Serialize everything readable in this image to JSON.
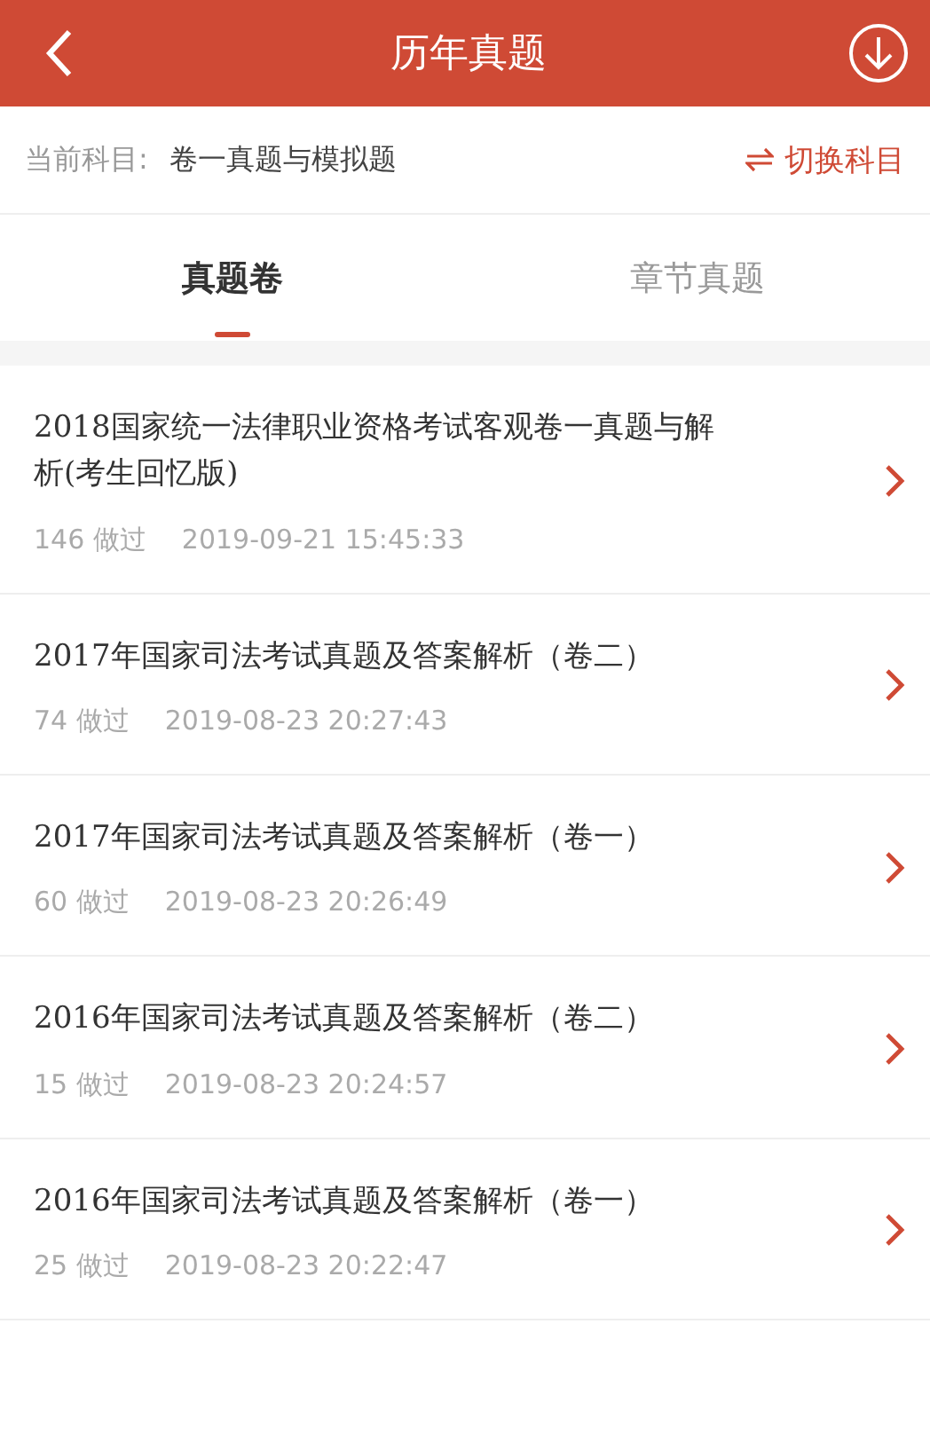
{
  "header": {
    "title": "历年真题"
  },
  "subject": {
    "label": "当前科目:",
    "value": "卷一真题与模拟题",
    "switch_label": "切换科目"
  },
  "tabs": [
    {
      "label": "真题卷",
      "selected": true
    },
    {
      "label": "章节真题",
      "selected": false
    }
  ],
  "papers": [
    {
      "title": "2018国家统一法律职业资格考试客观卷一真题与解析(考生回忆版)",
      "done": "146 做过",
      "time": "2019-09-21 15:45:33"
    },
    {
      "title": "2017年国家司法考试真题及答案解析（卷二）",
      "done": "74 做过",
      "time": "2019-08-23 20:27:43"
    },
    {
      "title": "2017年国家司法考试真题及答案解析（卷一）",
      "done": "60 做过",
      "time": "2019-08-23 20:26:49"
    },
    {
      "title": "2016年国家司法考试真题及答案解析（卷二）",
      "done": "15 做过",
      "time": "2019-08-23 20:24:57"
    },
    {
      "title": "2016年国家司法考试真题及答案解析（卷一）",
      "done": "25 做过",
      "time": "2019-08-23 20:22:47"
    }
  ]
}
